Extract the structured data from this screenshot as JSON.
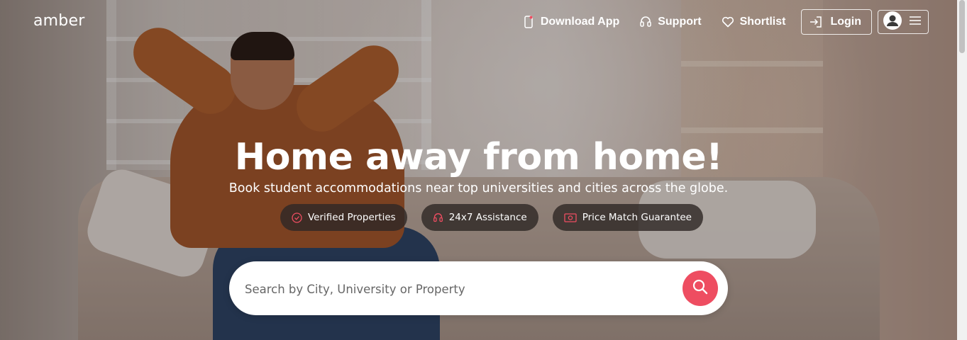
{
  "brand": {
    "logo": "amber",
    "accent_color": "#ee4d61"
  },
  "header": {
    "nav": [
      {
        "label": "Download App",
        "icon": "phone-icon"
      },
      {
        "label": "Support",
        "icon": "headset-icon"
      },
      {
        "label": "Shortlist",
        "icon": "heart-icon"
      }
    ],
    "login_label": "Login",
    "account_icons": [
      "user-avatar-icon",
      "menu-icon"
    ]
  },
  "hero": {
    "title": "Home away from home!",
    "subtitle": "Book student accommodations near top universities and cities across the globe.",
    "badges": [
      {
        "label": "Verified Properties",
        "icon": "check-circle-icon"
      },
      {
        "label": "24x7 Assistance",
        "icon": "headset-icon"
      },
      {
        "label": "Price Match Guarantee",
        "icon": "money-icon"
      }
    ]
  },
  "search": {
    "placeholder": "Search by City, University or Property",
    "value": ""
  }
}
